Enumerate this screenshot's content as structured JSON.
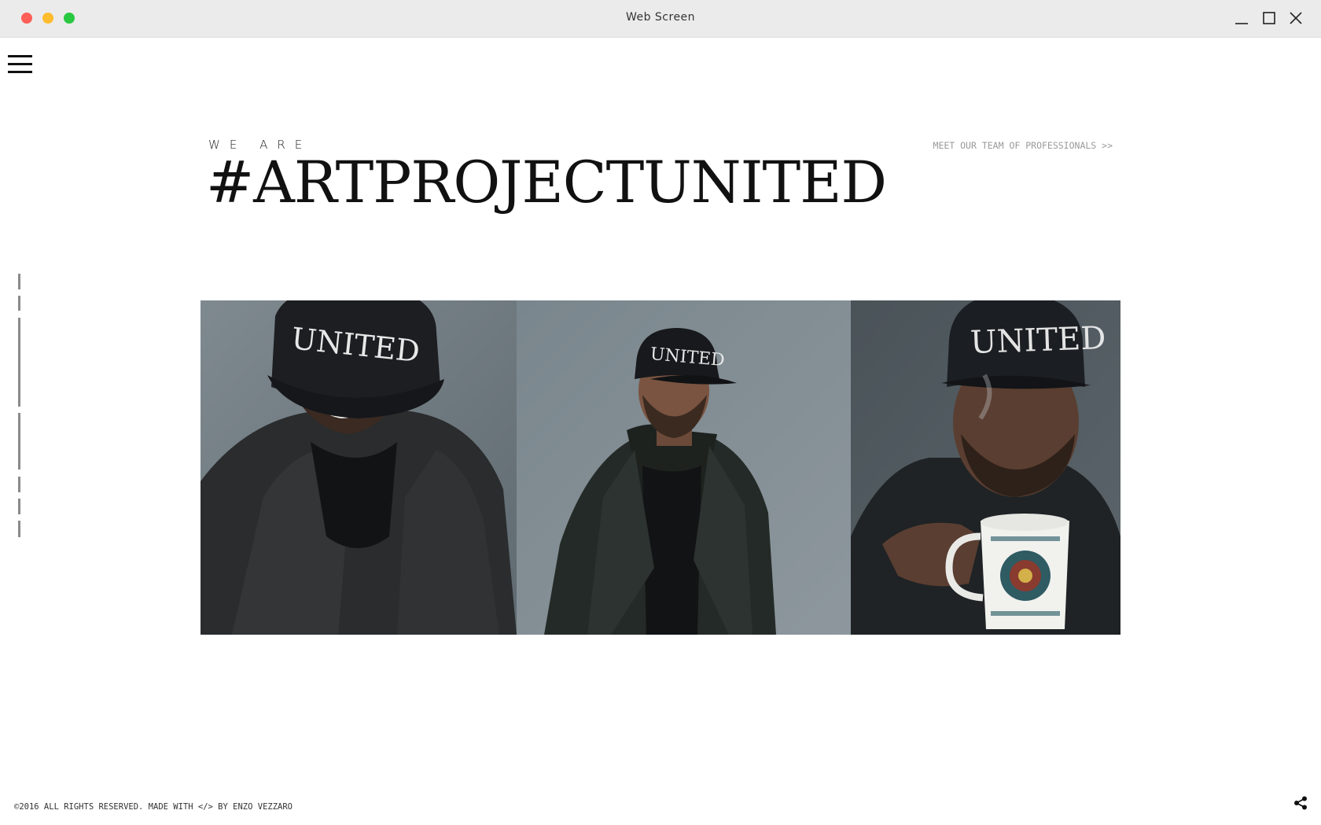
{
  "window": {
    "title": "Web Screen",
    "controls": {
      "close_color": "#ff5f57",
      "minimize_color": "#febc2e",
      "zoom_color": "#28c840"
    }
  },
  "nav": {
    "menu_icon": "hamburger-menu-icon"
  },
  "hero": {
    "eyebrow": "WE ARE",
    "title": "#ARTPROJECTUNITED",
    "team_link": "MEET OUR TEAM OF PROFESSIONALS >>"
  },
  "gallery": {
    "cap_text": "UNITED",
    "photos": [
      {
        "subject": "man-looking-down-portrait"
      },
      {
        "subject": "man-in-coat-portrait"
      },
      {
        "subject": "man-with-mug-portrait"
      }
    ]
  },
  "footer": {
    "copyright": "©2016 ALL RIGHTS RESERVED. MADE WITH </> BY ENZO VEZZARO",
    "share_icon": "share-icon"
  },
  "colors": {
    "text_dark": "#111111",
    "link_gray": "#9a9a9a",
    "backdrop_gray": "#6f7b82"
  }
}
